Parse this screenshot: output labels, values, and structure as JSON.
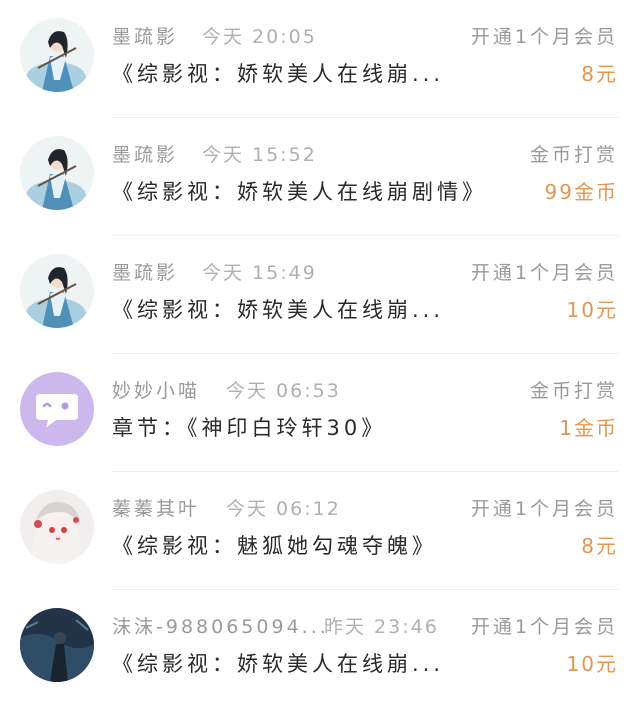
{
  "colors": {
    "accent": "#e3964f",
    "name": "#9a9a9a",
    "title": "#2a2a2a"
  },
  "records": [
    {
      "avatar": "ink-swordsman-avatar",
      "name": "墨疏影",
      "time": "今天 20:05",
      "action": "开通1个月会员",
      "title": "《综影视：娇软美人在线崩...",
      "amount": "8元"
    },
    {
      "avatar": "ink-swordsman-avatar",
      "name": "墨疏影",
      "time": "今天 15:52",
      "action": "金币打赏",
      "title": "《综影视：娇软美人在线崩剧情》",
      "amount": "99金币"
    },
    {
      "avatar": "ink-swordsman-avatar",
      "name": "墨疏影",
      "time": "今天 15:49",
      "action": "开通1个月会员",
      "title": "《综影视：娇软美人在线崩...",
      "amount": "10元"
    },
    {
      "avatar": "chat-bubble-avatar",
      "name": "妙妙小喵",
      "time": "今天 06:53",
      "action": "金币打赏",
      "title": "章节：《神印白玲轩30》",
      "amount": "1金币"
    },
    {
      "avatar": "fox-girl-avatar",
      "name": "蓁蓁其叶",
      "time": "今天 06:12",
      "action": "开通1个月会员",
      "title": "《综影视：魅狐她勾魂夺魄》",
      "amount": "8元"
    },
    {
      "avatar": "dark-scene-avatar",
      "name": "沫沫-988065094...",
      "time": "昨天 23:46",
      "action": "开通1个月会员",
      "title": "《综影视：娇软美人在线崩...",
      "amount": "10元"
    }
  ]
}
